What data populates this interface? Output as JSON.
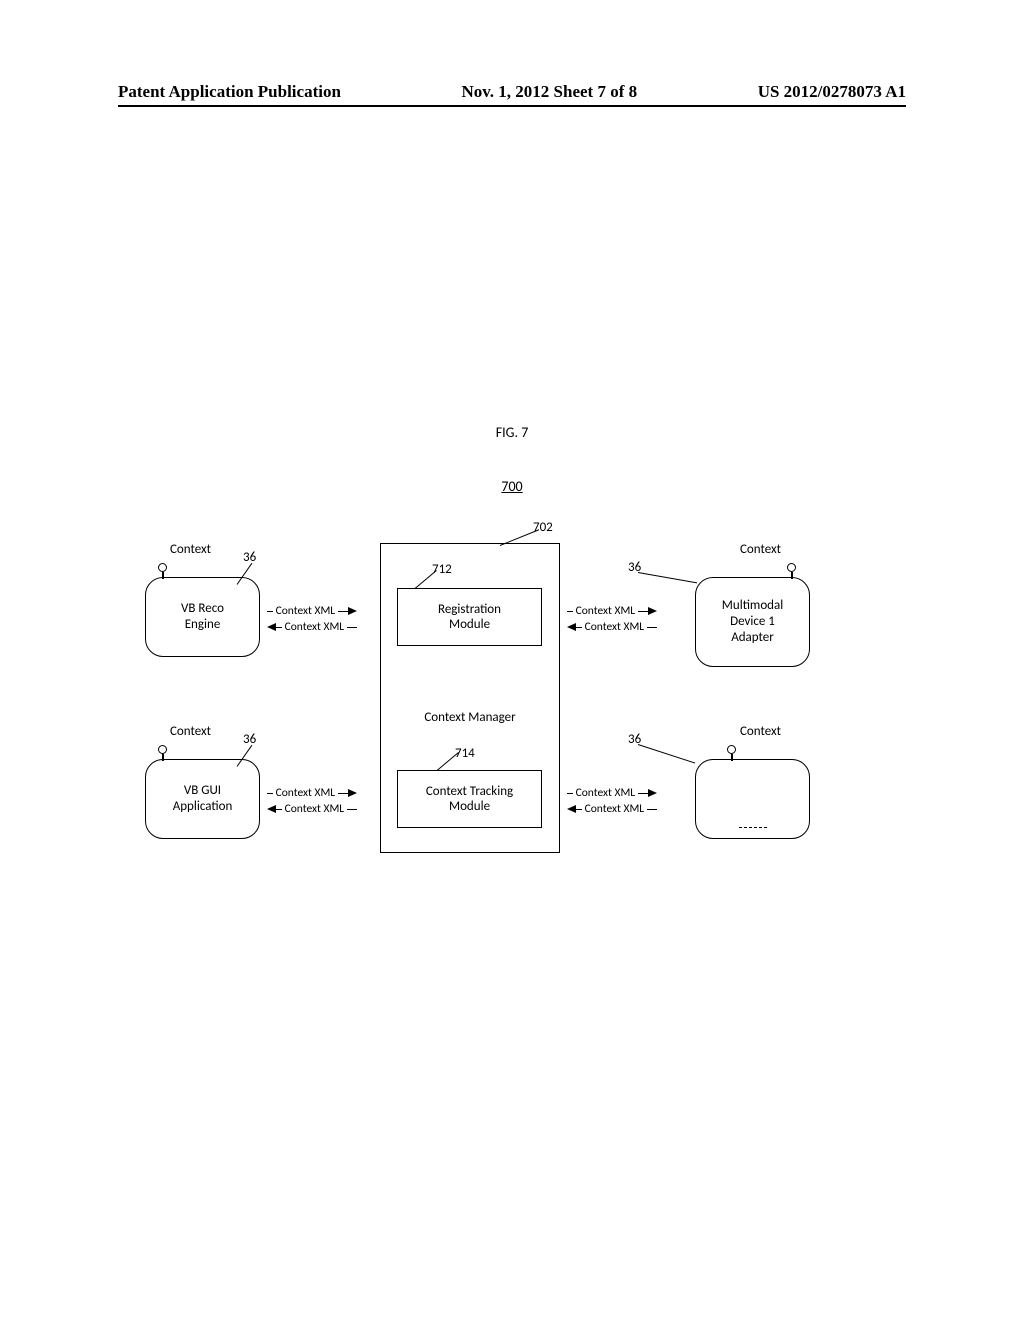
{
  "header": {
    "left": "Patent Application Publication",
    "center": "Nov. 1, 2012  Sheet 7 of 8",
    "right": "US 2012/0278073 A1"
  },
  "figure": {
    "label": "FIG. 7",
    "number": "700"
  },
  "refnums": {
    "r702": "702",
    "r712": "712",
    "r714": "714",
    "r36a": "36",
    "r36b": "36",
    "r36c": "36",
    "r36d": "36"
  },
  "labels": {
    "context": "Context",
    "context_xml": "Context XML",
    "context_manager": "Context Manager"
  },
  "boxes": {
    "vb_reco": "VB Reco\nEngine",
    "vb_gui": "VB GUI\nApplication",
    "mm_adapter": "Multimodal\nDevice 1\nAdapter",
    "reg_module": "Registration\nModule",
    "track_module": "Context Tracking\nModule"
  }
}
